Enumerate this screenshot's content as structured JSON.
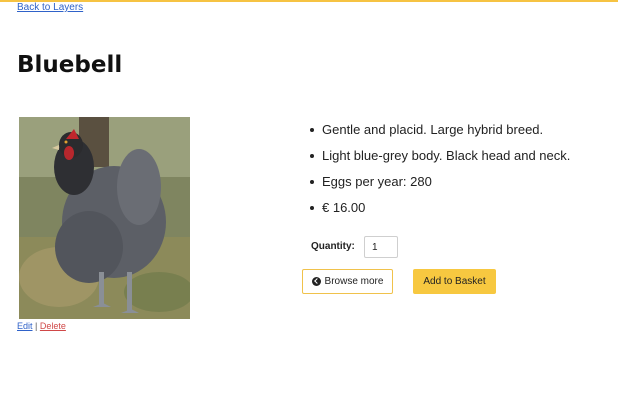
{
  "nav": {
    "back_link": "Back to Layers"
  },
  "product": {
    "title": "Bluebell",
    "image_alt": "Grey hen standing on grass",
    "features": [
      "Gentle and placid. Large hybrid breed.",
      "Light blue-grey body. Black head and neck.",
      "Eggs per year: 280",
      "€ 16.00"
    ]
  },
  "image_actions": {
    "edit": "Edit",
    "separator": "|",
    "delete": "Delete"
  },
  "order": {
    "quantity_label": "Quantity:",
    "quantity_value": "1",
    "browse_label": "Browse more",
    "basket_label": "Add to Basket"
  },
  "colors": {
    "accent": "#f7c840",
    "link": "#2f62c9",
    "delete": "#d04848"
  }
}
